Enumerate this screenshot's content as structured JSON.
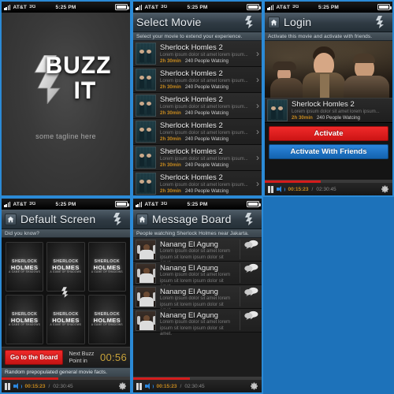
{
  "status_bar": {
    "carrier": "AT&T",
    "network": "3G",
    "time": "5:25 PM",
    "signal_icon": "signal-bars-icon",
    "battery_icon": "battery-icon"
  },
  "colors": {
    "page_background": "#1d72ba",
    "frame_border": "#2b8ad6",
    "accent_red": "#d41c1c",
    "accent_blue": "#1463ae",
    "accent_gold": "#c78a1e",
    "buzz_timer_gold": "#c9a33a"
  },
  "screens": {
    "splash": {
      "name": "splash-screen",
      "logo_line1": "BUZZ",
      "logo_line2": "IT",
      "tagline": "some tagline here"
    },
    "select_movie": {
      "title": "Select Movie",
      "subtitle": "Select your movie to extend your experience.",
      "movies": [
        {
          "title": "Sherlock Homles 2",
          "desc": "Lorem ipsum dolor sit amet lorem ipsum...",
          "duration": "2h 30min",
          "watching": "240 People Watcing"
        },
        {
          "title": "Sherlock Homles 2",
          "desc": "Lorem ipsum dolor sit amet lorem ipsum...",
          "duration": "2h 30min",
          "watching": "240 People Watcing"
        },
        {
          "title": "Sherlock Homles 2",
          "desc": "Lorem ipsum dolor sit amet lorem ipsum...",
          "duration": "2h 30min",
          "watching": "240 People Watcing"
        },
        {
          "title": "Sherlock Homles 2",
          "desc": "Lorem ipsum dolor sit amet lorem ipsum...",
          "duration": "2h 30min",
          "watching": "240 People Watcing"
        },
        {
          "title": "Sherlock Homles 2",
          "desc": "Lorem ipsum dolor sit amet lorem ipsum...",
          "duration": "2h 30min",
          "watching": "240 People Watcing"
        },
        {
          "title": "Sherlock Homles 2",
          "desc": "Lorem ipsum dolor sit amet lorem ipsum...",
          "duration": "2h 30min",
          "watching": "240 People Watcing"
        }
      ]
    },
    "login": {
      "title": "Login",
      "subtitle": "Activate this movie and activate with friends.",
      "hero_alt": "sherlock-holmes-cast-photo",
      "movie": {
        "title": "Sherlock Homles 2",
        "desc": "Lorem ipsum dolor sit amet lorem ipsum...",
        "duration": "2h 30min",
        "watching": "240 People Watcing"
      },
      "activate_label": "Activate",
      "activate_friends_label": "Activate With Friends"
    },
    "default_screen": {
      "title": "Default Screen",
      "subtitle": "Did you know?",
      "tiles": [
        {
          "line1": "SHERLOCK",
          "line2": "HOLMES",
          "line3": "A GAME OF SHADOWS"
        },
        {
          "line1": "SHERLOCK",
          "line2": "HOLMES",
          "line3": "A GAME OF SHADOWS"
        },
        {
          "line1": "SHERLOCK",
          "line2": "HOLMES",
          "line3": "A GAME OF SHADOWS"
        },
        {
          "line1": "SHERLOCK",
          "line2": "HOLMES",
          "line3": "A GAME OF SHADOWS"
        },
        {
          "line1": "SHERLOCK",
          "line2": "HOLMES",
          "line3": "A GAME OF SHADOWS"
        },
        {
          "line1": "SHERLOCK",
          "line2": "HOLMES",
          "line3": "A GAME OF SHADOWS"
        }
      ],
      "board_button": "Go to the Board",
      "next_buzz_label_l1": "Next Buzz",
      "next_buzz_label_l2": "Point in",
      "next_buzz_timer": "00:56",
      "fact_text": "Random prepopulated general movie facts."
    },
    "message_board": {
      "title": "Message Board",
      "subtitle": "People watching Sherlock Holmes near Jakarta.",
      "messages": [
        {
          "name": "Nanang El Agung",
          "body": "Lorem ipsum dolor sit amet lorem ipsum sit lorem ipsum dolor sit amet."
        },
        {
          "name": "Nanang El Agung",
          "body": "Lorem ipsum dolor sit amet lorem ipsum sit lorem ipsum dolor sit amet."
        },
        {
          "name": "Nanang El Agung",
          "body": "Lorem ipsum dolor sit amet lorem ipsum sit lorem ipsum dolor sit amet."
        },
        {
          "name": "Nanang El Agung",
          "body": "Lorem ipsum dolor sit amet lorem ipsum sit lorem ipsum dolor sit amet."
        }
      ]
    }
  },
  "player": {
    "pause_icon": "pause-icon",
    "volume_icon": "volume-icon",
    "current_time": "00:15:23",
    "separator": "/",
    "total_time": "02:30:45",
    "settings_icon": "gear-icon",
    "progress_percent": 44
  }
}
